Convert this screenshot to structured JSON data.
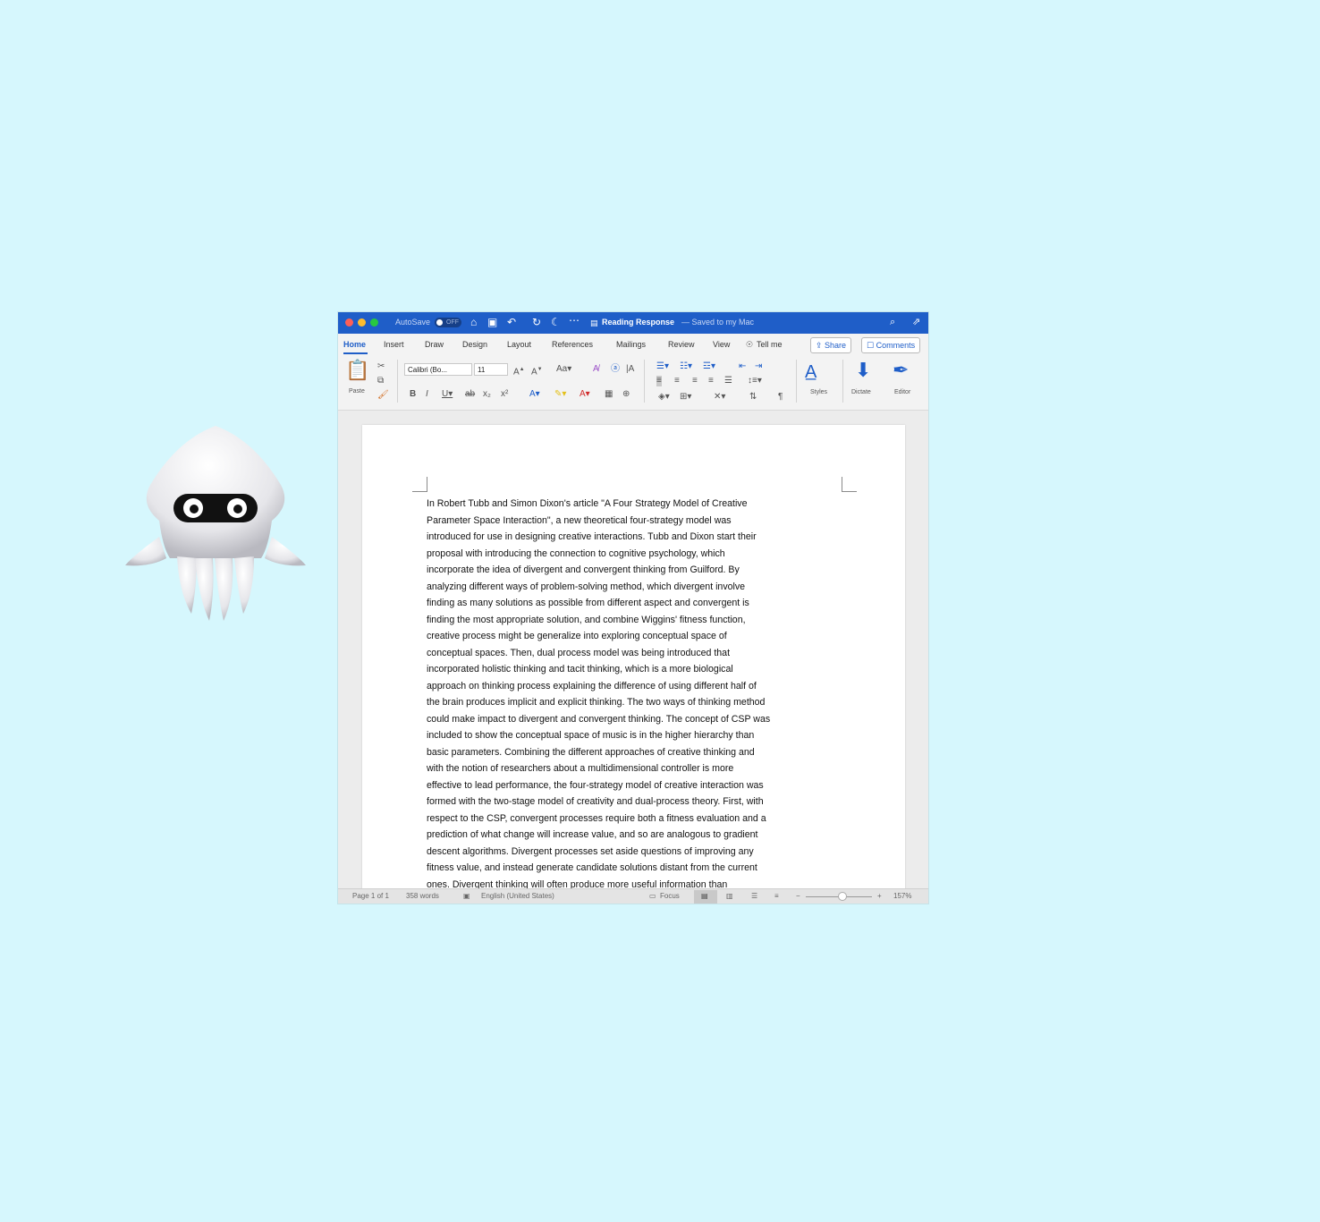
{
  "window": {
    "autosave_label": "AutoSave",
    "autosave_state": "OFF",
    "doc_title": "Reading Response",
    "doc_status": "— Saved to my Mac",
    "traffic_lights": {
      "close": "#fe5f57",
      "minimize": "#febc2e",
      "zoom": "#28c840"
    }
  },
  "titlebar_icons": [
    "home-icon",
    "save-icon",
    "undo-icon",
    "redo-icon",
    "refresh-icon",
    "more-icon",
    "search-icon",
    "share-person-icon"
  ],
  "tabs": [
    {
      "label": "Home",
      "active": true
    },
    {
      "label": "Insert"
    },
    {
      "label": "Draw"
    },
    {
      "label": "Design"
    },
    {
      "label": "Layout"
    },
    {
      "label": "References"
    },
    {
      "label": "Mailings"
    },
    {
      "label": "Review"
    },
    {
      "label": "View"
    },
    {
      "label": "Tell me"
    }
  ],
  "actions": {
    "share": "Share",
    "comments": "Comments"
  },
  "ribbon": {
    "paste": "Paste",
    "font_name": "Calibri (Bo...",
    "font_size": "11",
    "styles": "Styles",
    "dictate": "Dictate",
    "editor": "Editor"
  },
  "document": {
    "lines": [
      "In Robert Tubb and Simon Dixon's article \"A Four Strategy Model of Creative",
      "Parameter Space Interaction\", a new theoretical four-strategy model was",
      "introduced for use in designing creative interactions. Tubb and Dixon start their",
      "proposal with introducing the connection to cognitive psychology, which",
      "incorporate the idea of divergent and convergent thinking from Guilford. By",
      "analyzing different ways of problem-solving method, which divergent involve",
      "finding as many solutions as possible from different aspect and convergent is",
      "finding the most appropriate solution, and combine Wiggins' fitness function,",
      "creative process might be generalize into exploring conceptual space of",
      "conceptual spaces. Then, dual process model was being introduced that",
      "incorporated holistic thinking and tacit thinking, which is a more biological",
      "approach on thinking process explaining the difference of using different half of",
      "the brain produces implicit and explicit thinking. The two ways of thinking method",
      "could make impact to divergent and convergent thinking. The concept of CSP was",
      "included to show the conceptual space of music is in the higher hierarchy than",
      "basic parameters. Combining the different approaches of creative thinking and",
      "with the notion of researchers about a multidimensional controller is more",
      "effective to lead performance, the four-strategy model of creative interaction was",
      "formed with the two-stage model of creativity and dual-process theory. First, with",
      "respect to the CSP, convergent processes require both a fitness evaluation and a",
      "prediction of what change will increase value, and so are analogous to gradient",
      "descent algorithms. Divergent processes set aside questions of improving any",
      "fitness value, and instead generate candidate solutions distant from the current",
      "ones. Divergent thinking will often produce more useful information than"
    ]
  },
  "statusbar": {
    "page": "Page 1 of 1",
    "words": "358 words",
    "language": "English (United States)",
    "focus": "Focus",
    "zoom_minus": "−",
    "zoom_plus": "+",
    "zoom": "157%",
    "zoom_level_fraction": 0.55
  }
}
